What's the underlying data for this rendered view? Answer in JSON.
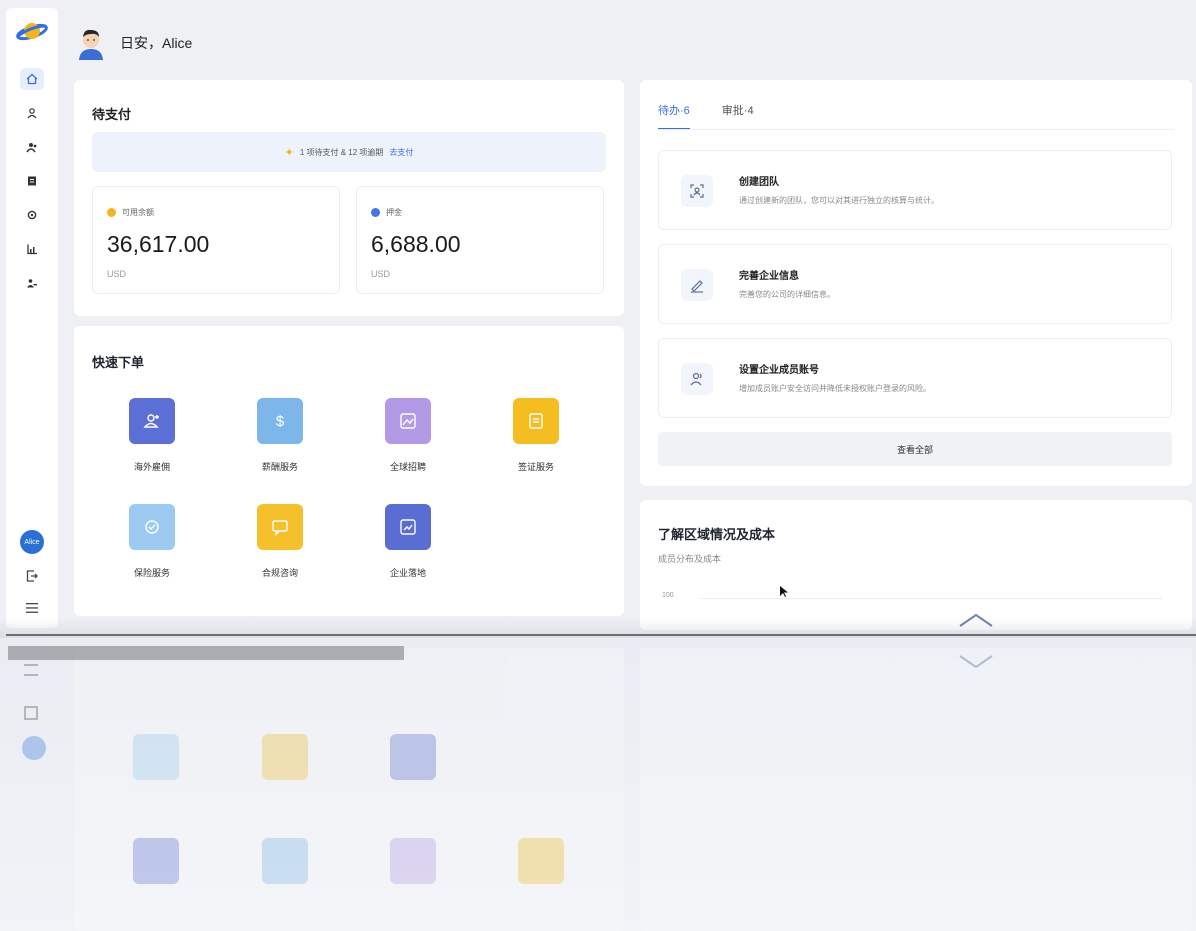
{
  "header": {
    "greeting": "日安，Alice"
  },
  "sidebar": {
    "items": [
      {
        "icon": "home-icon"
      },
      {
        "icon": "user-icon"
      },
      {
        "icon": "users-icon"
      },
      {
        "icon": "document-icon"
      },
      {
        "icon": "settings-icon"
      },
      {
        "icon": "chart-icon"
      },
      {
        "icon": "team-icon"
      }
    ],
    "user_badge": "Alice",
    "colors": {
      "accent": "#3b6cf0",
      "badge": "#2a70d6"
    }
  },
  "payment": {
    "title": "待支付",
    "notice_text": "1 项待支付 & 12 项逾期",
    "notice_link": "去支付",
    "boxes": [
      {
        "label": "可用余额",
        "value": "36,617.00",
        "currency": "USD",
        "dot_color": "#f3b51b"
      },
      {
        "label": "押金",
        "value": "6,688.00",
        "currency": "USD",
        "dot_color": "#4a72e8"
      }
    ]
  },
  "quick_order": {
    "title": "快速下单",
    "items": [
      {
        "label": "海外雇佣",
        "color": "#5b6fd6",
        "icon": "add-user-icon"
      },
      {
        "label": "薪酬服务",
        "color": "#7cb6ea",
        "icon": "dollar-icon"
      },
      {
        "label": "全球招聘",
        "color": "#b49ae6",
        "icon": "image-icon"
      },
      {
        "label": "签证服务",
        "color": "#f5bd1f",
        "icon": "passport-icon"
      },
      {
        "label": "保险服务",
        "color": "#9ccaf0",
        "icon": "shield-icon"
      },
      {
        "label": "合规咨询",
        "color": "#f5c02a",
        "icon": "chat-icon"
      },
      {
        "label": "企业落地",
        "color": "#5a6dd2",
        "icon": "chart-icon"
      }
    ]
  },
  "todo": {
    "tabs": [
      {
        "label": "待办·6",
        "active": true
      },
      {
        "label": "审批·4",
        "active": false
      }
    ],
    "tasks": [
      {
        "title": "创建团队",
        "desc": "通过创建新的团队，您可以对其进行独立的核算与统计。",
        "icon": "team-frame-icon"
      },
      {
        "title": "完善企业信息",
        "desc": "完善您的公司的详细信息。",
        "icon": "edit-pen-icon"
      },
      {
        "title": "设置企业成员账号",
        "desc": "增加成员账户安全访问并降低未授权账户登录的风险。",
        "icon": "members-icon"
      }
    ],
    "view_all": "查看全部"
  },
  "region": {
    "title": "了解区域情况及成本",
    "subtitle": "成员分布及成本",
    "axis_tick": "100"
  }
}
